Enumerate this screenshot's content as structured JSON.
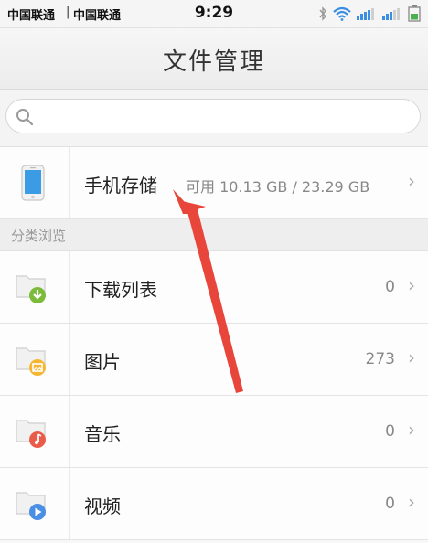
{
  "status_bar": {
    "carrier1": "中国联通",
    "separator": "|",
    "carrier2": "中国联通",
    "time": "9:29"
  },
  "header": {
    "title": "文件管理"
  },
  "search": {
    "placeholder": "",
    "value": ""
  },
  "storage": {
    "label": "手机存储",
    "info": "可用 10.13 GB / 23.29 GB",
    "chevron": "›"
  },
  "section": {
    "title": "分类浏览"
  },
  "categories": [
    {
      "label": "下载列表",
      "count": "0",
      "chevron": "›",
      "icon": "download-badge",
      "badge_color": "#7cbb3a"
    },
    {
      "label": "图片",
      "count": "273",
      "chevron": "›",
      "icon": "image-badge",
      "badge_color": "#f5b731"
    },
    {
      "label": "音乐",
      "count": "0",
      "chevron": "›",
      "icon": "music-badge",
      "badge_color": "#ea5b4a"
    },
    {
      "label": "视频",
      "count": "0",
      "chevron": "›",
      "icon": "play-badge",
      "badge_color": "#4a8ee5"
    }
  ],
  "colors": {
    "annotation_arrow": "#e8463b",
    "phone_screen": "#3b9be5"
  }
}
